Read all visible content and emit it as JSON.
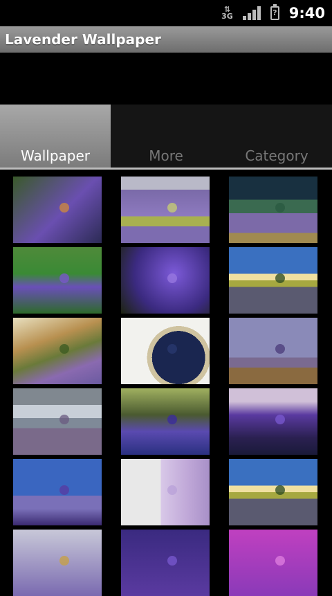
{
  "status_bar": {
    "network": "3G",
    "time": "9:40"
  },
  "app": {
    "title": "Lavender Wallpaper"
  },
  "tabs": [
    {
      "label": "Wallpaper",
      "active": true
    },
    {
      "label": "More",
      "active": false
    },
    {
      "label": "Category",
      "active": false
    }
  ],
  "colors": {
    "accent_tab": "#9a9a9a",
    "lavender": "#7a5bc4"
  },
  "thumbnails": [
    {
      "bg": "linear-gradient(135deg,#3a5a2a,#6a4fb0 55%,#2c2b55)",
      "accent": "#d28a3a"
    },
    {
      "bg": "linear-gradient(#b9b9c8 0 20%,#7a6aa8 20%,#8e7ac0 60%,#a8b050 60% 75%,#7d6cb0 75%)",
      "accent": "#c8d070"
    },
    {
      "bg": "linear-gradient(#183040 0 35%,#3a6a50 35% 55%,#7c6aa8 55% 85%,#a08a50 85%)",
      "accent": "#2a5a40"
    },
    {
      "bg": "linear-gradient(#4f8a3a,#3a8a35 40%,#6a4fb8 60%,#2d6a2a)",
      "accent": "#7b55d0"
    },
    {
      "bg": "radial-gradient(circle at 60% 40%,#7c5ad8,#3b2a80 60%,#1d2410)",
      "accent": "#9a7ae0"
    },
    {
      "bg": "linear-gradient(#3a70c0 0 40%,#f0e0a0 40% 50%,#a6a840 50% 60%,#5a5a70 60%)",
      "accent": "#2a4a20"
    },
    {
      "bg": "linear-gradient(160deg,#e8e0c0,#b89050 35%,#6a7a3a 55%,#8a6ab0 75%,#6a5aa0)",
      "accent": "#3a5a20"
    },
    {
      "bg": "radial-gradient(circle at 65% 60%,#1a2650 0 38%,#cfc3a0 38% 45%,#f2f2ee 45%)",
      "accent": "#2a3a70"
    },
    {
      "bg": "linear-gradient(#8a8ab8 0 60%,#7a6a90 60% 75%,#8a6a40 75%)",
      "accent": "#4a3a7a"
    },
    {
      "bg": "linear-gradient(#808890 0 25%,#c8cfd8 25% 45%,#7f8a98 45% 60%,#7a6a8a 60%)",
      "accent": "#6a5a80"
    },
    {
      "bg": "linear-gradient(#a0b060,#4a5a30 40%,#5a4ab0 65%,#2a3080)",
      "accent": "#3a2aa0"
    },
    {
      "bg": "linear-gradient(#d0c0d8 0 20%,#5a3aa0 40%,#2a2050 75%,#1a1a3a)",
      "accent": "#7a5ad0"
    },
    {
      "bg": "linear-gradient(#3a66c0 0 55%,#7a70b8 55% 75%,#3a2a70)",
      "accent": "#5a3aa0"
    },
    {
      "bg": "linear-gradient(90deg,#e8e8e8 0 45%,#d8c8e8 45%,#c0a8d8 75%,#a890c8)",
      "accent": "#b8a0d8"
    },
    {
      "bg": "linear-gradient(#3a70c0 0 40%,#f0e0a0 40% 50%,#a6a840 50% 60%,#5a5a70 60%)",
      "accent": "#2a4a20"
    },
    {
      "bg": "linear-gradient(#c8c8d8,#7a6ab0)",
      "accent": "#c8a040"
    },
    {
      "bg": "linear-gradient(#3a2a80,#5a3aa0)",
      "accent": "#7a5ad0"
    },
    {
      "bg": "linear-gradient(#c040c0,#8a3ab8)",
      "accent": "#e080e0"
    }
  ]
}
